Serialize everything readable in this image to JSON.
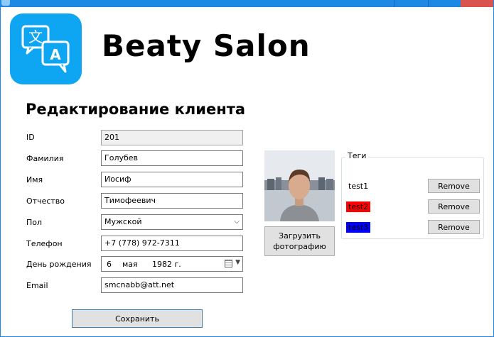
{
  "window": {
    "accent_color": "#1e88e5",
    "close_color": "#d9534f"
  },
  "header": {
    "app_title": "Beaty Salon",
    "logo_icon": "translate-icon",
    "logo_glyph_left": "文",
    "logo_glyph_right": "A",
    "logo_color": "#0ea5f2"
  },
  "form": {
    "title": "Редактирование клиента",
    "fields": [
      {
        "label": "ID",
        "value": "201"
      },
      {
        "label": "Фамилия",
        "value": "Голубев"
      },
      {
        "label": "Имя",
        "value": "Иосиф"
      },
      {
        "label": "Отчество",
        "value": "Тимофеевич"
      },
      {
        "label": "Пол",
        "value": "Мужской"
      },
      {
        "label": "Телефон",
        "value": "+7 (778) 972-7311"
      },
      {
        "label": "День рождения",
        "day": "6",
        "month": "мая",
        "year": "1982 г."
      },
      {
        "label": "Email",
        "value": "smcnabb@att.net"
      }
    ],
    "save_label": "Сохранить"
  },
  "photo": {
    "upload_label_line1": "Загрузить",
    "upload_label_line2": "фотографию"
  },
  "tags": {
    "group_label": "Теги",
    "items": [
      {
        "name": "test1",
        "color": "#ffffff"
      },
      {
        "name": "test2",
        "color": "#ff0000"
      },
      {
        "name": "test3",
        "color": "#0000ff"
      }
    ],
    "remove_label": "Remove"
  }
}
